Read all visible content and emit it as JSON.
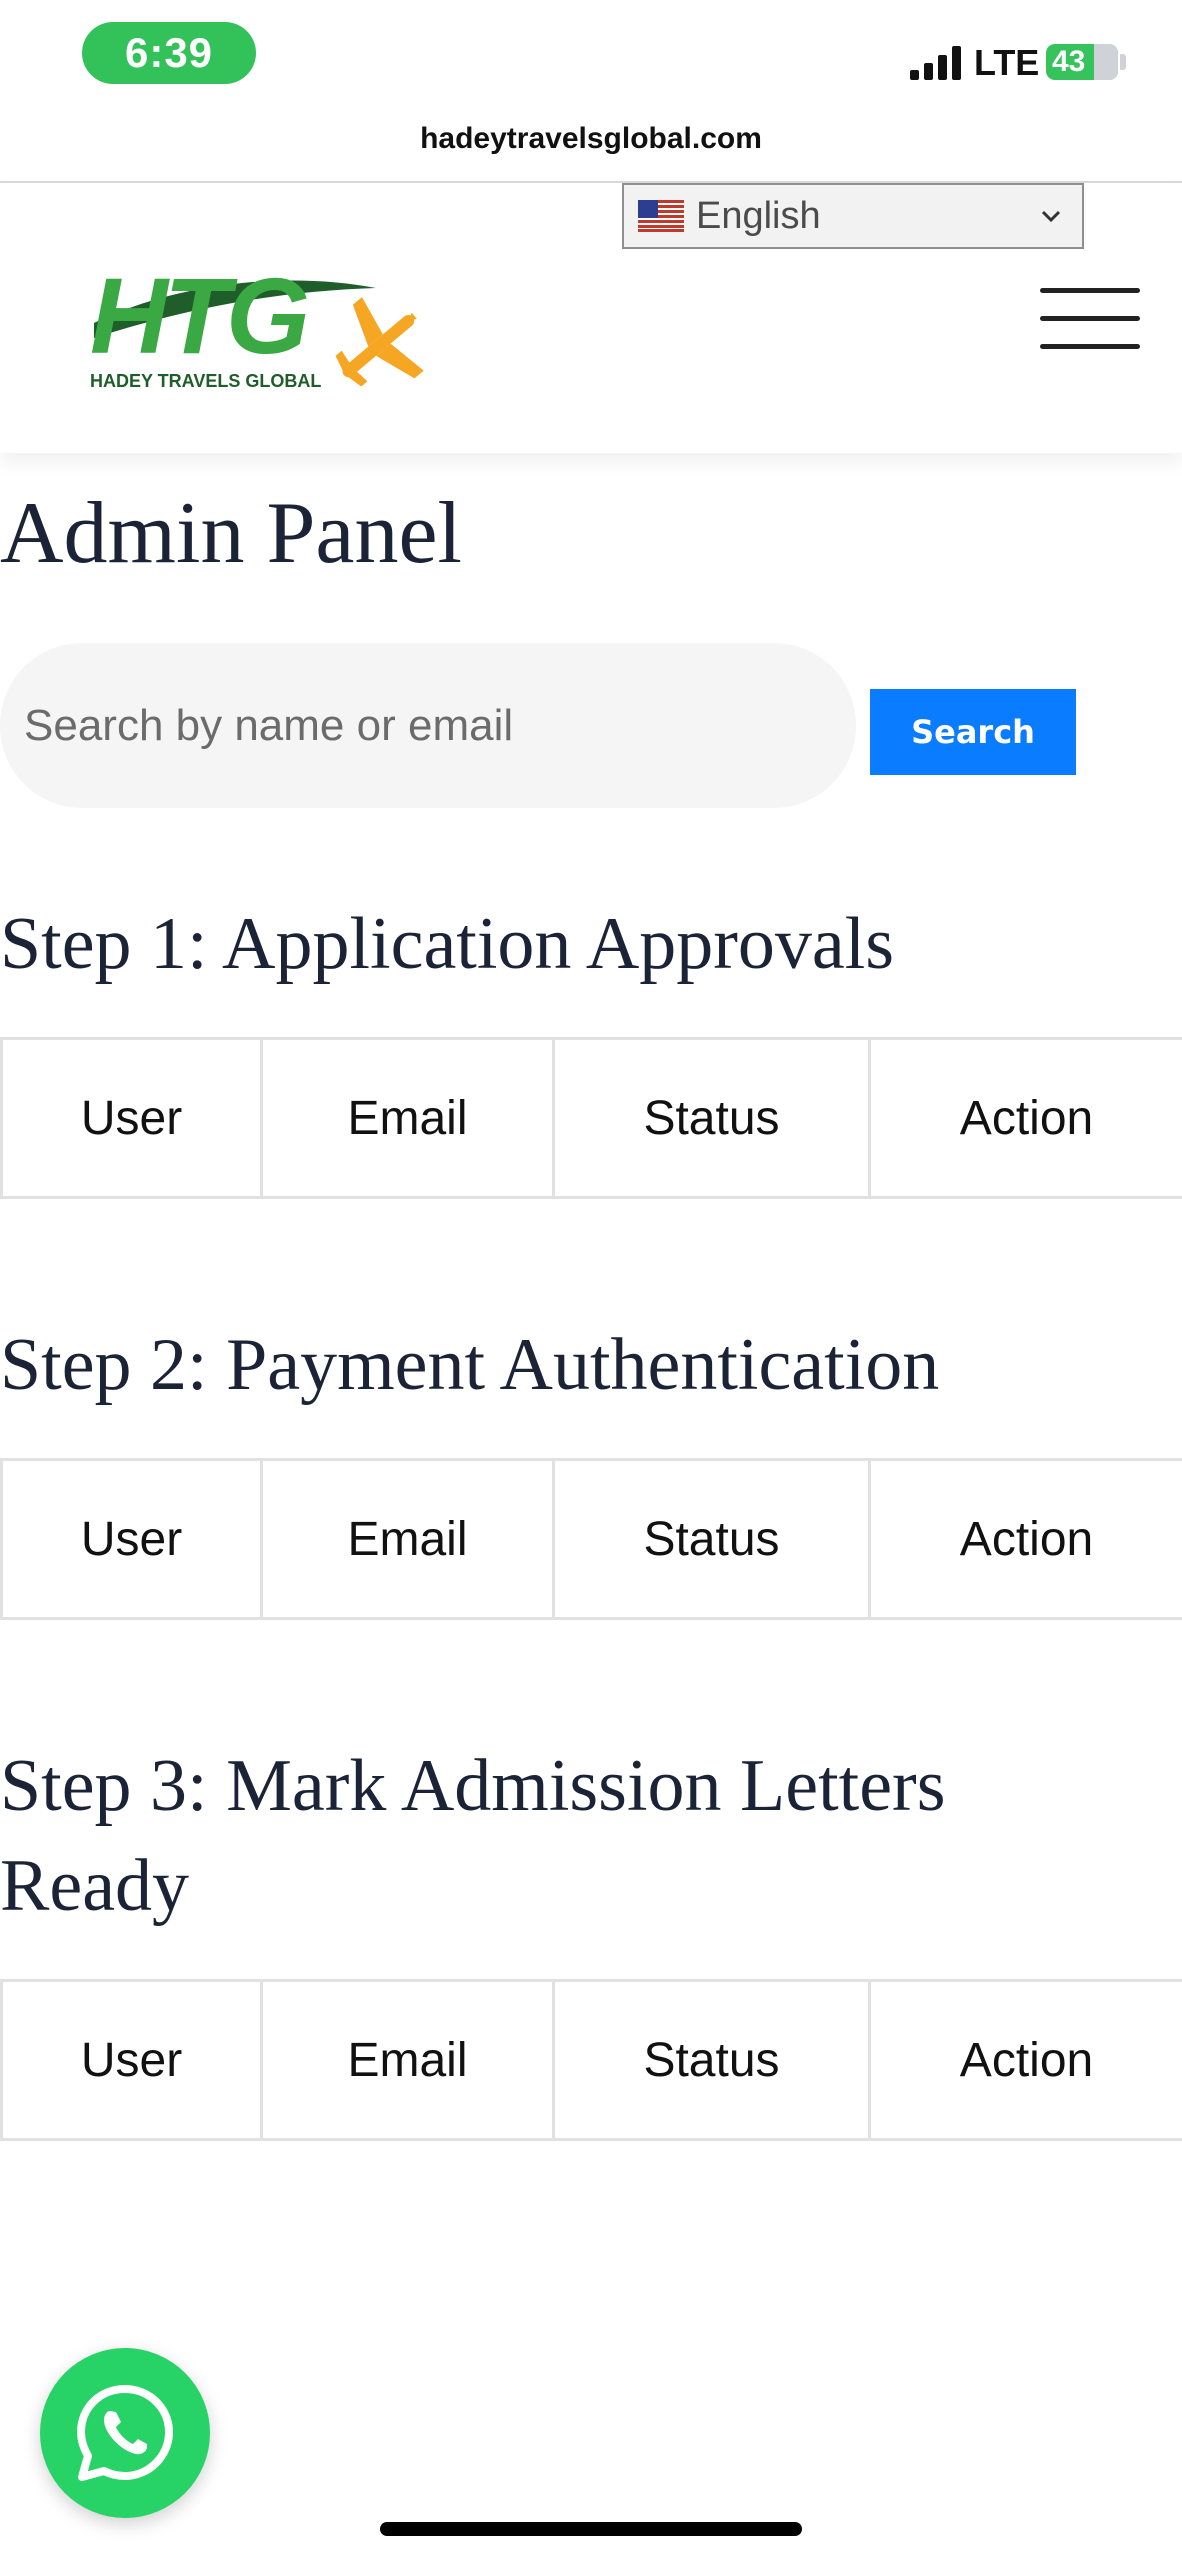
{
  "status_bar": {
    "time": "6:39",
    "network": "LTE",
    "battery": "43"
  },
  "browser": {
    "url": "hadeytravelsglobal.com"
  },
  "header": {
    "language": "English",
    "logo_text": "HTG",
    "logo_tagline": "HADEY TRAVELS GLOBAL"
  },
  "main": {
    "title": "Admin Panel",
    "search": {
      "placeholder": "Search by name or email",
      "button_label": "Search"
    },
    "sections": [
      {
        "title": "Step 1: Application Approvals",
        "columns": [
          "User",
          "Email",
          "Status",
          "Action"
        ]
      },
      {
        "title": "Step 2: Payment Authentication",
        "columns": [
          "User",
          "Email",
          "Status",
          "Action"
        ]
      },
      {
        "title": "Step 3: Mark Admission Letters Ready",
        "columns": [
          "User",
          "Email",
          "Status",
          "Action"
        ]
      }
    ]
  },
  "colors": {
    "accent": "#0a7cff",
    "logo_green": "#3aa843",
    "logo_dark_green": "#1f5e2a",
    "logo_orange": "#f5a623",
    "whatsapp": "#27d366"
  }
}
